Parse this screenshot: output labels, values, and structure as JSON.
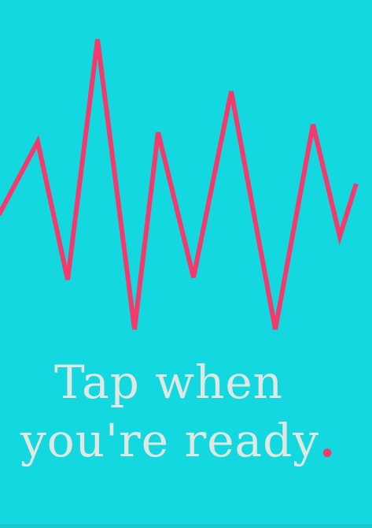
{
  "prompt": {
    "line1": "Tap when",
    "line2": "you're ready",
    "dot": "."
  },
  "icons": {
    "wave": "pulse-waveform-icon"
  },
  "colors": {
    "background": "#13d8df",
    "wave": "#f43a6b",
    "text": "#e1e8e2",
    "dot": "#f43a6b",
    "bottom_bar": "#1ac9d0"
  }
}
